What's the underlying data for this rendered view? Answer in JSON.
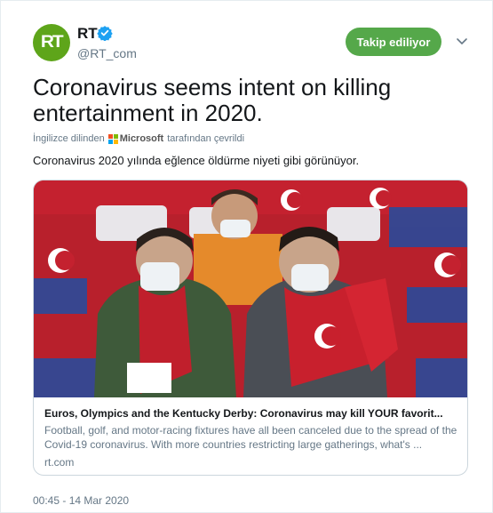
{
  "account": {
    "avatar_text": "RT",
    "name": "RT",
    "handle": "@RT_com",
    "follow_label": "Takip ediliyor"
  },
  "tweet": {
    "text": "Coronavirus seems intent on killing entertainment in 2020.",
    "translated_from": "İngilizce dilinden",
    "translator": "Microsoft",
    "translated_by_suffix": "tarafından çevrildi",
    "translation": "Coronavirus 2020 yılında eğlence öldürme niyeti gibi görünüyor."
  },
  "link_card": {
    "title": "Euros, Olympics and the Kentucky Derby: Coronavirus may kill YOUR favorit...",
    "description": "Football, golf, and motor-racing fixtures have all been canceled due to the spread of the Covid-19 coronavirus. With more countries restricting large gatherings, what's ...",
    "domain": "rt.com"
  },
  "timestamp": "00:45 - 14 Mar 2020",
  "colors": {
    "follow_button": "#55a84a",
    "avatar": "#5ea51a",
    "verified": "#1da1f2",
    "secondary_text": "#657786"
  }
}
